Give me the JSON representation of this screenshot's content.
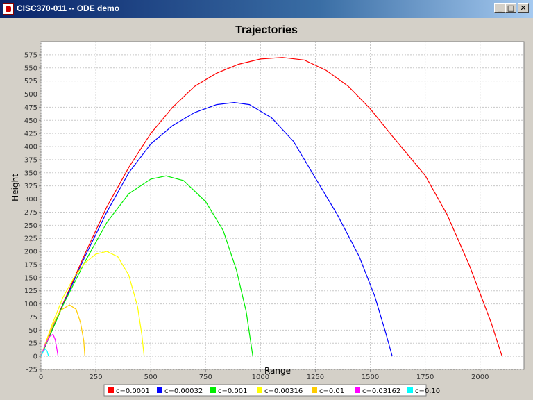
{
  "window": {
    "title": "CISC370-011 -- ODE demo",
    "minimize_glyph": "_",
    "maximize_glyph": "□",
    "close_glyph": "✕"
  },
  "chart_data": {
    "type": "line",
    "title": "Trajectories",
    "xlabel": "Range",
    "ylabel": "Height",
    "xlim": [
      0,
      2200
    ],
    "ylim": [
      -25,
      600
    ],
    "x_ticks": [
      0,
      250,
      500,
      750,
      1000,
      1250,
      1500,
      1750,
      2000
    ],
    "y_ticks": [
      -25,
      0,
      25,
      50,
      75,
      100,
      125,
      150,
      175,
      200,
      225,
      250,
      275,
      300,
      325,
      350,
      375,
      400,
      425,
      450,
      475,
      500,
      525,
      550,
      575
    ],
    "grid": true,
    "legend_position": "bottom",
    "series": [
      {
        "name": "c=0.0001",
        "color": "#ff0000",
        "points": [
          [
            0,
            0
          ],
          [
            100,
            100
          ],
          [
            200,
            195
          ],
          [
            300,
            285
          ],
          [
            400,
            360
          ],
          [
            500,
            425
          ],
          [
            600,
            475
          ],
          [
            700,
            515
          ],
          [
            800,
            540
          ],
          [
            900,
            557
          ],
          [
            1000,
            567
          ],
          [
            1100,
            570
          ],
          [
            1200,
            565
          ],
          [
            1300,
            545
          ],
          [
            1400,
            515
          ],
          [
            1500,
            472
          ],
          [
            1600,
            420
          ],
          [
            1750,
            345
          ],
          [
            1850,
            270
          ],
          [
            1950,
            175
          ],
          [
            2050,
            65
          ],
          [
            2100,
            0
          ]
        ]
      },
      {
        "name": "c=0.00032",
        "color": "#0000ff",
        "points": [
          [
            0,
            0
          ],
          [
            100,
            98
          ],
          [
            200,
            190
          ],
          [
            300,
            275
          ],
          [
            400,
            350
          ],
          [
            500,
            405
          ],
          [
            600,
            440
          ],
          [
            700,
            465
          ],
          [
            800,
            480
          ],
          [
            880,
            484
          ],
          [
            950,
            480
          ],
          [
            1050,
            455
          ],
          [
            1150,
            410
          ],
          [
            1250,
            340
          ],
          [
            1350,
            270
          ],
          [
            1450,
            190
          ],
          [
            1520,
            115
          ],
          [
            1570,
            45
          ],
          [
            1600,
            0
          ]
        ]
      },
      {
        "name": "c=0.001",
        "color": "#00ee00",
        "points": [
          [
            0,
            0
          ],
          [
            100,
            97
          ],
          [
            200,
            180
          ],
          [
            300,
            255
          ],
          [
            400,
            310
          ],
          [
            500,
            338
          ],
          [
            570,
            344
          ],
          [
            650,
            335
          ],
          [
            750,
            295
          ],
          [
            830,
            240
          ],
          [
            890,
            165
          ],
          [
            935,
            85
          ],
          [
            965,
            0
          ]
        ]
      },
      {
        "name": "c=0.00316",
        "color": "#ffff00",
        "points": [
          [
            0,
            0
          ],
          [
            50,
            60
          ],
          [
            100,
            112
          ],
          [
            150,
            150
          ],
          [
            200,
            178
          ],
          [
            250,
            195
          ],
          [
            300,
            200
          ],
          [
            350,
            190
          ],
          [
            400,
            155
          ],
          [
            440,
            95
          ],
          [
            460,
            40
          ],
          [
            470,
            0
          ]
        ]
      },
      {
        "name": "c=0.01",
        "color": "#ffcc00",
        "points": [
          [
            0,
            0
          ],
          [
            30,
            35
          ],
          [
            60,
            65
          ],
          [
            90,
            88
          ],
          [
            130,
            98
          ],
          [
            160,
            90
          ],
          [
            180,
            65
          ],
          [
            195,
            30
          ],
          [
            200,
            0
          ]
        ]
      },
      {
        "name": "c=0.03162",
        "color": "#ff00ff",
        "points": [
          [
            0,
            0
          ],
          [
            20,
            22
          ],
          [
            40,
            38
          ],
          [
            55,
            42
          ],
          [
            65,
            32
          ],
          [
            72,
            15
          ],
          [
            78,
            0
          ]
        ]
      },
      {
        "name": "c=0.10",
        "color": "#00ffff",
        "points": [
          [
            0,
            0
          ],
          [
            10,
            9
          ],
          [
            20,
            14
          ],
          [
            28,
            10
          ],
          [
            32,
            4
          ],
          [
            35,
            0
          ]
        ]
      }
    ]
  }
}
